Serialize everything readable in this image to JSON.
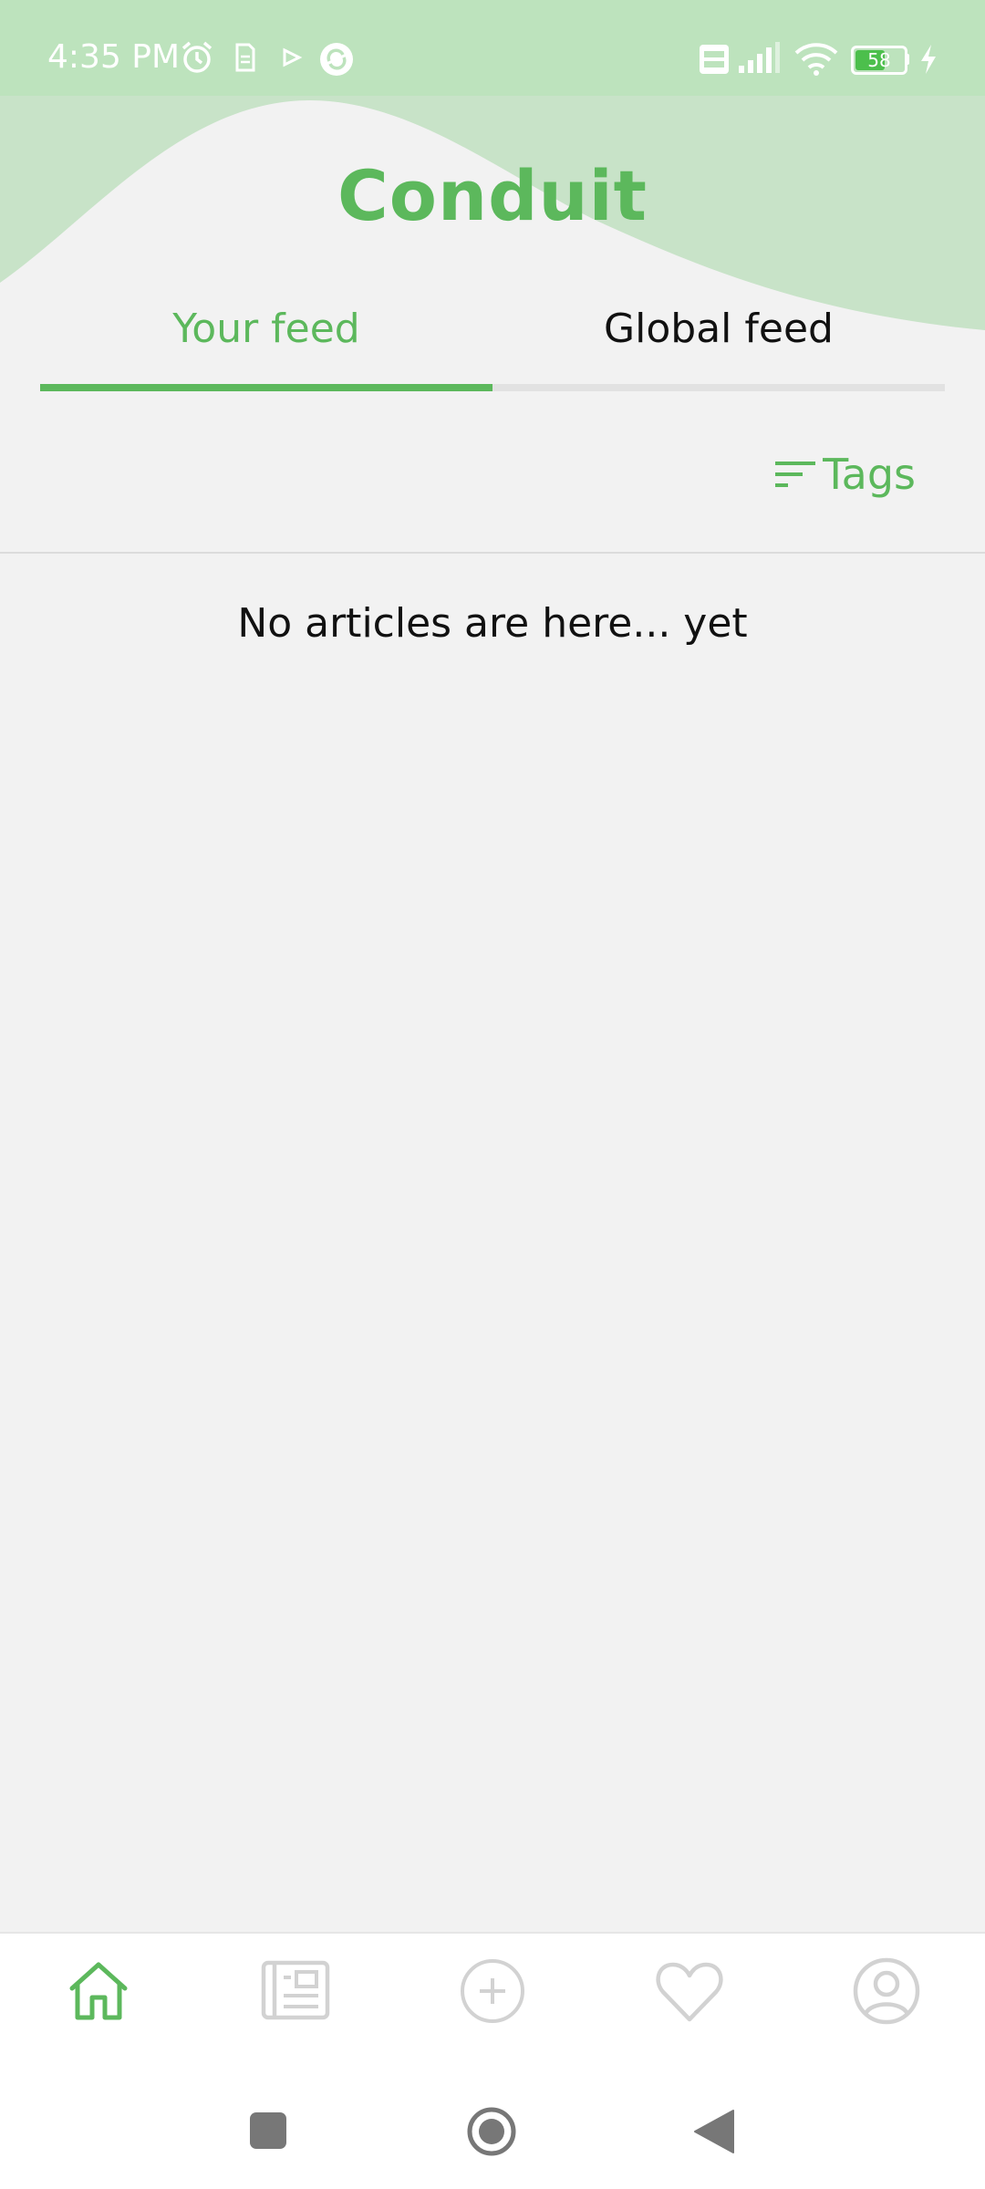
{
  "status_bar": {
    "time": "4:35 PM",
    "battery_level": "58",
    "left_icons": [
      "alarm-icon",
      "sim-icon",
      "play-icon",
      "sync-icon"
    ],
    "right_icons": [
      "volte-icon",
      "signal-icon",
      "wifi-icon",
      "battery-icon",
      "charging-icon"
    ]
  },
  "app": {
    "title": "Conduit"
  },
  "colors": {
    "accent": "#5cb85c",
    "header_wave": "#c8e3c8",
    "background": "#f2f2f2"
  },
  "tabs": [
    {
      "label": "Your feed",
      "active": true
    },
    {
      "label": "Global feed",
      "active": false
    }
  ],
  "filter": {
    "tags_label": "Tags",
    "icon": "filter-lines-icon"
  },
  "feed": {
    "empty_message": "No articles are here... yet"
  },
  "bottom_nav": [
    {
      "name": "home",
      "icon": "home-icon",
      "active": true
    },
    {
      "name": "articles",
      "icon": "newspaper-icon",
      "active": false
    },
    {
      "name": "new-article",
      "icon": "add-circle-icon",
      "active": false
    },
    {
      "name": "favorites",
      "icon": "heart-icon",
      "active": false
    },
    {
      "name": "profile",
      "icon": "profile-icon",
      "active": false
    }
  ],
  "system_nav": [
    "recents-icon",
    "home-circle-icon",
    "back-icon"
  ]
}
